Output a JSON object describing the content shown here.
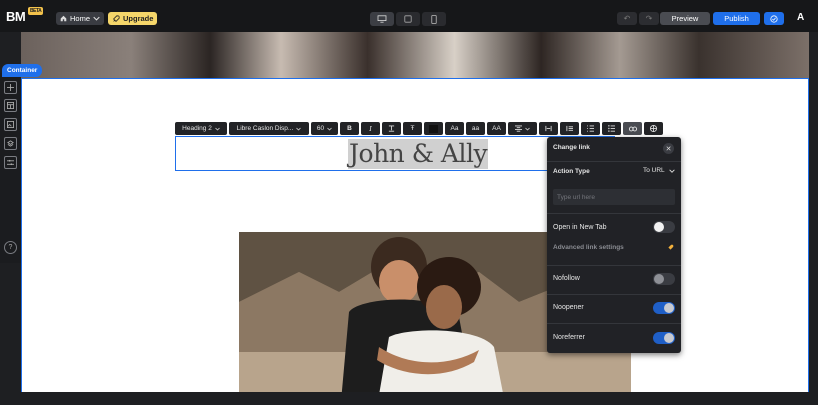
{
  "topbar": {
    "logo": "BM",
    "logo_badge": "BETA",
    "home_label": "Home",
    "upgrade_label": "Upgrade",
    "preview_label": "Preview",
    "publish_label": "Publish",
    "avatar_letter": "A"
  },
  "canvas": {
    "container_tag": "Container",
    "heading_text": "John & Ally"
  },
  "text_toolbar": {
    "heading_level": "Heading 2",
    "font_family": "Libre Caslon Disp...",
    "font_size": "60",
    "bold": "B",
    "italic": "I",
    "strike": "Ŧ",
    "case_title": "Aa",
    "case_lower": "aa",
    "case_upper": "AA"
  },
  "link_panel": {
    "title": "Change link",
    "action_type_label": "Action Type",
    "action_type_value": "To URL",
    "url_placeholder": "Type url here",
    "open_new_tab_label": "Open in New Tab",
    "open_new_tab_on": false,
    "advanced_label": "Advanced link settings",
    "nofollow_label": "Nofollow",
    "nofollow_on": false,
    "noopener_label": "Noopener",
    "noopener_on": true,
    "noreferrer_label": "Noreferrer",
    "noreferrer_on": true
  },
  "colors": {
    "accent": "#1f6feb",
    "upgrade": "#f5d66a",
    "panel_bg": "#212226",
    "toggle_on": "#1f5fc7"
  }
}
